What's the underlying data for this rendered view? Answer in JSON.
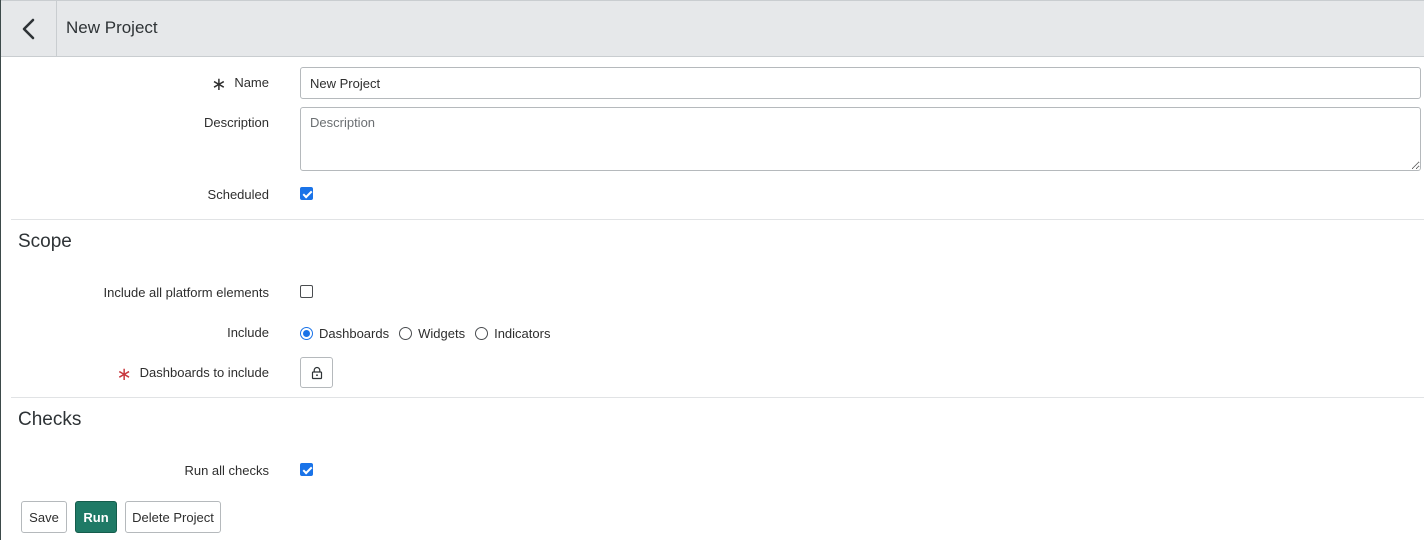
{
  "header": {
    "title": "New Project",
    "back_icon": "chevron-left-icon"
  },
  "form": {
    "name": {
      "label": "Name",
      "value": "New Project",
      "required": true
    },
    "description": {
      "label": "Description",
      "value": "",
      "placeholder": "Description"
    },
    "scheduled": {
      "label": "Scheduled",
      "checked": true
    }
  },
  "scope": {
    "title": "Scope",
    "include_all_platform": {
      "label": "Include all platform elements",
      "checked": false
    },
    "include": {
      "label": "Include",
      "options": [
        "Dashboards",
        "Widgets",
        "Indicators"
      ],
      "selected": "Dashboards"
    },
    "dashboards_to_include": {
      "label": "Dashboards to include",
      "required": true,
      "icon": "lock-icon"
    }
  },
  "checks": {
    "title": "Checks",
    "run_all_checks": {
      "label": "Run all checks",
      "checked": true
    }
  },
  "actions": {
    "save_label": "Save",
    "run_label": "Run",
    "delete_label": "Delete Project"
  },
  "colors": {
    "accent": "#1a73e8",
    "primary_button": "#1f7a66",
    "required_mark": "#c8373d"
  }
}
